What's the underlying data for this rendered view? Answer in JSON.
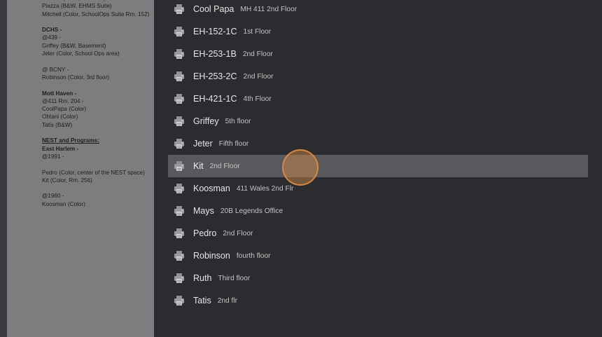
{
  "document": {
    "lines": [
      {
        "text": "Posada (Color, Rm. 253)",
        "style": ""
      },
      {
        "text": "Piazza (B&W, EHMS Suite)",
        "style": ""
      },
      {
        "text": "Mitchell (Color, SchoolOps Suite Rm. 152)",
        "style": ""
      },
      {
        "text": "",
        "style": ""
      },
      {
        "text": "DCHS -",
        "style": "bold"
      },
      {
        "text": "@439 -",
        "style": ""
      },
      {
        "text": "Griffey (B&W, Basement)",
        "style": ""
      },
      {
        "text": "Jeter (Color, School Ops area)",
        "style": ""
      },
      {
        "text": "",
        "style": ""
      },
      {
        "text": "@ BCNY -",
        "style": ""
      },
      {
        "text": "Robinson (Color, 3rd floor)",
        "style": ""
      },
      {
        "text": "",
        "style": ""
      },
      {
        "text": "Mott Haven -",
        "style": "bold"
      },
      {
        "text": "@411 Rm. 204 -",
        "style": ""
      },
      {
        "text": "CoolPapa (Color)",
        "style": ""
      },
      {
        "text": "Ohtani (Color)",
        "style": ""
      },
      {
        "text": "Tatis (B&W)",
        "style": ""
      },
      {
        "text": "",
        "style": ""
      },
      {
        "text": "NEST and Programs:",
        "style": "bold underline"
      },
      {
        "text": "East Harlem -",
        "style": "bold"
      },
      {
        "text": "@1991 -",
        "style": ""
      },
      {
        "text": "",
        "style": ""
      },
      {
        "text": "Pedro (Color, center of the NEST space)",
        "style": ""
      },
      {
        "text": "Kit (Color, Rm. 256)",
        "style": ""
      },
      {
        "text": "",
        "style": ""
      },
      {
        "text": "@1960 -",
        "style": ""
      },
      {
        "text": "Koosman (Color)",
        "style": ""
      }
    ]
  },
  "printers": [
    {
      "name": "Cool Papa",
      "location": "MH 411 2nd Floor",
      "selected": false
    },
    {
      "name": "EH-152-1C",
      "location": "1st Floor",
      "selected": false
    },
    {
      "name": "EH-253-1B",
      "location": "2nd Floor",
      "selected": false
    },
    {
      "name": "EH-253-2C",
      "location": "2nd Floor",
      "selected": false
    },
    {
      "name": "EH-421-1C",
      "location": "4th Floor",
      "selected": false
    },
    {
      "name": "Griffey",
      "location": "5th floor",
      "selected": false
    },
    {
      "name": "Jeter",
      "location": "Fifth floor",
      "selected": false
    },
    {
      "name": "Kit",
      "location": "2nd Floor",
      "selected": true
    },
    {
      "name": "Koosman",
      "location": "411 Wales 2nd Flr",
      "selected": false
    },
    {
      "name": "Mays",
      "location": "20B Legends Office",
      "selected": false
    },
    {
      "name": "Pedro",
      "location": "2nd Floor",
      "selected": false
    },
    {
      "name": "Robinson",
      "location": "fourth floor",
      "selected": false
    },
    {
      "name": "Ruth",
      "location": "Third floor",
      "selected": false
    },
    {
      "name": "Tatis",
      "location": "2nd flr",
      "selected": false
    }
  ],
  "icons": {
    "printer": "printer-icon"
  },
  "colors": {
    "panel_bg": "#2b2c30",
    "selected_row": "#58595c",
    "click_marker": "#e08c41"
  }
}
